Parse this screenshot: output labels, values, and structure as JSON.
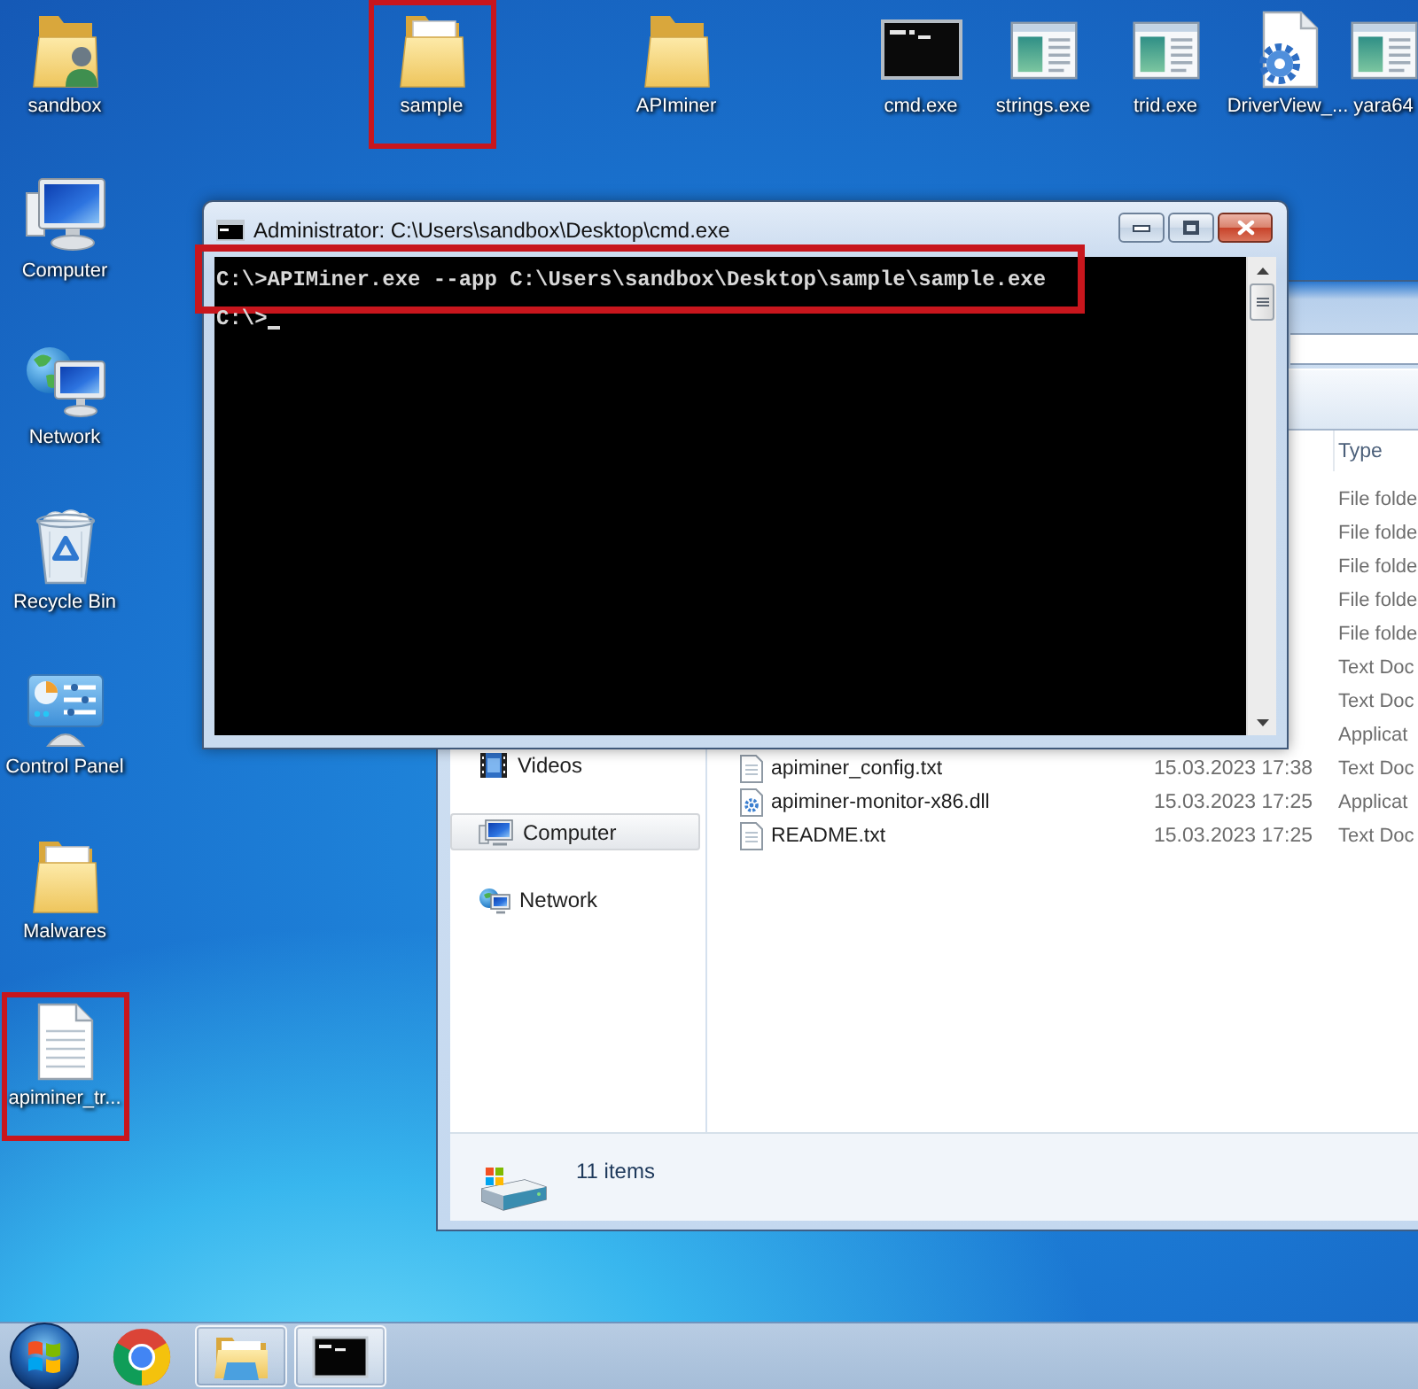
{
  "desktop_icons": [
    {
      "label": "sandbox",
      "kind": "user-folder",
      "highlighted": false
    },
    {
      "label": "sample",
      "kind": "document-folder",
      "highlighted": true
    },
    {
      "label": "APIminer",
      "kind": "folder",
      "highlighted": false
    },
    {
      "label": "cmd.exe",
      "kind": "console",
      "highlighted": false
    },
    {
      "label": "strings.exe",
      "kind": "app",
      "highlighted": false
    },
    {
      "label": "trid.exe",
      "kind": "app",
      "highlighted": false
    },
    {
      "label": "DriverView_...",
      "kind": "gear-document",
      "highlighted": false
    },
    {
      "label": "yara64",
      "kind": "app",
      "highlighted": false
    },
    {
      "label": "Computer",
      "kind": "computer",
      "highlighted": false
    },
    {
      "label": "Network",
      "kind": "network",
      "highlighted": false
    },
    {
      "label": "Recycle Bin",
      "kind": "recycle-bin",
      "highlighted": false
    },
    {
      "label": "Control Panel",
      "kind": "control-panel",
      "highlighted": false
    },
    {
      "label": "Malwares",
      "kind": "document-folder",
      "highlighted": false
    },
    {
      "label": "apiminer_tr...",
      "kind": "text-file",
      "highlighted": true
    }
  ],
  "cmd_window": {
    "title": "Administrator: C:\\Users\\sandbox\\Desktop\\cmd.exe",
    "lines": [
      {
        "text": "C:\\>APIMiner.exe --app C:\\Users\\sandbox\\Desktop\\sample\\sample.exe",
        "highlighted": true,
        "cursor": false
      },
      {
        "text": "C:\\>",
        "highlighted": false,
        "cursor": true
      }
    ]
  },
  "explorer_window": {
    "nav_items": [
      {
        "label": "Videos",
        "kind": "videos",
        "selected": false
      },
      {
        "label": "Computer",
        "kind": "computer",
        "selected": true
      },
      {
        "label": "Network",
        "kind": "network",
        "selected": false
      }
    ],
    "columns": [
      "Type"
    ],
    "rows": [
      {
        "type": "File folde"
      },
      {
        "type": "File folde"
      },
      {
        "type": "File folde"
      },
      {
        "type": "File folde"
      },
      {
        "type": "File folde"
      },
      {
        "type": "Text Doc"
      },
      {
        "type": "Text Doc"
      },
      {
        "type": "Applicat"
      },
      {
        "name": "apiminer_config.txt",
        "kind": "text",
        "date": "15.03.2023 17:38",
        "type": "Text Doc"
      },
      {
        "name": "apiminer-monitor-x86.dll",
        "kind": "dll",
        "date": "15.03.2023 17:25",
        "type": "Applicat"
      },
      {
        "name": "README.txt",
        "kind": "text",
        "date": "15.03.2023 17:25",
        "type": "Text Doc"
      }
    ],
    "status": "11 items"
  },
  "taskbar": {
    "items": [
      {
        "kind": "browser",
        "running": false,
        "active": false
      },
      {
        "kind": "explorer",
        "running": true,
        "active": false
      },
      {
        "kind": "console",
        "running": true,
        "active": true
      }
    ]
  }
}
